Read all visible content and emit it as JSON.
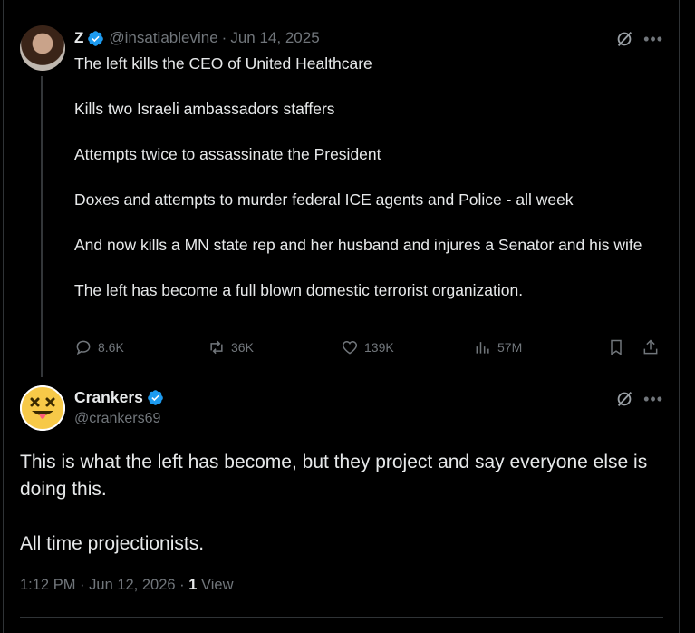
{
  "parent_tweet": {
    "display_name": "Z",
    "handle": "@insatiablevine",
    "separator": "·",
    "date": "Jun 14, 2025",
    "paragraphs": [
      "The left kills the CEO of United Healthcare",
      "Kills two Israeli ambassadors staffers",
      "Attempts twice to assassinate the President",
      "Doxes and attempts to murder federal ICE agents and Police - all week",
      "And now kills a MN state rep and her husband and injures a Senator and his wife",
      "The left has become a full blown domestic terrorist organization."
    ],
    "replies": "8.6K",
    "reposts": "36K",
    "likes": "139K",
    "views": "57M"
  },
  "main_tweet": {
    "display_name": "Crankers",
    "handle": "@crankers69",
    "paragraphs": [
      "This is what the left has become, but they project and say everyone else is doing this.",
      "All time projectionists."
    ],
    "time": "1:12 PM",
    "separator": "·",
    "date": "Jun 12, 2026",
    "view_count": "1",
    "view_label": "View"
  },
  "icons": {
    "more": "more-icon",
    "grok": "grok-icon",
    "verified": "verified-badge-icon",
    "reply": "reply-icon",
    "repost": "repost-icon",
    "like": "heart-icon",
    "views": "views-icon",
    "bookmark": "bookmark-icon",
    "share": "share-icon"
  },
  "colors": {
    "background": "#000000",
    "text": "#e7e9ea",
    "secondary": "#71767b",
    "verified": "#1d9bf0"
  }
}
